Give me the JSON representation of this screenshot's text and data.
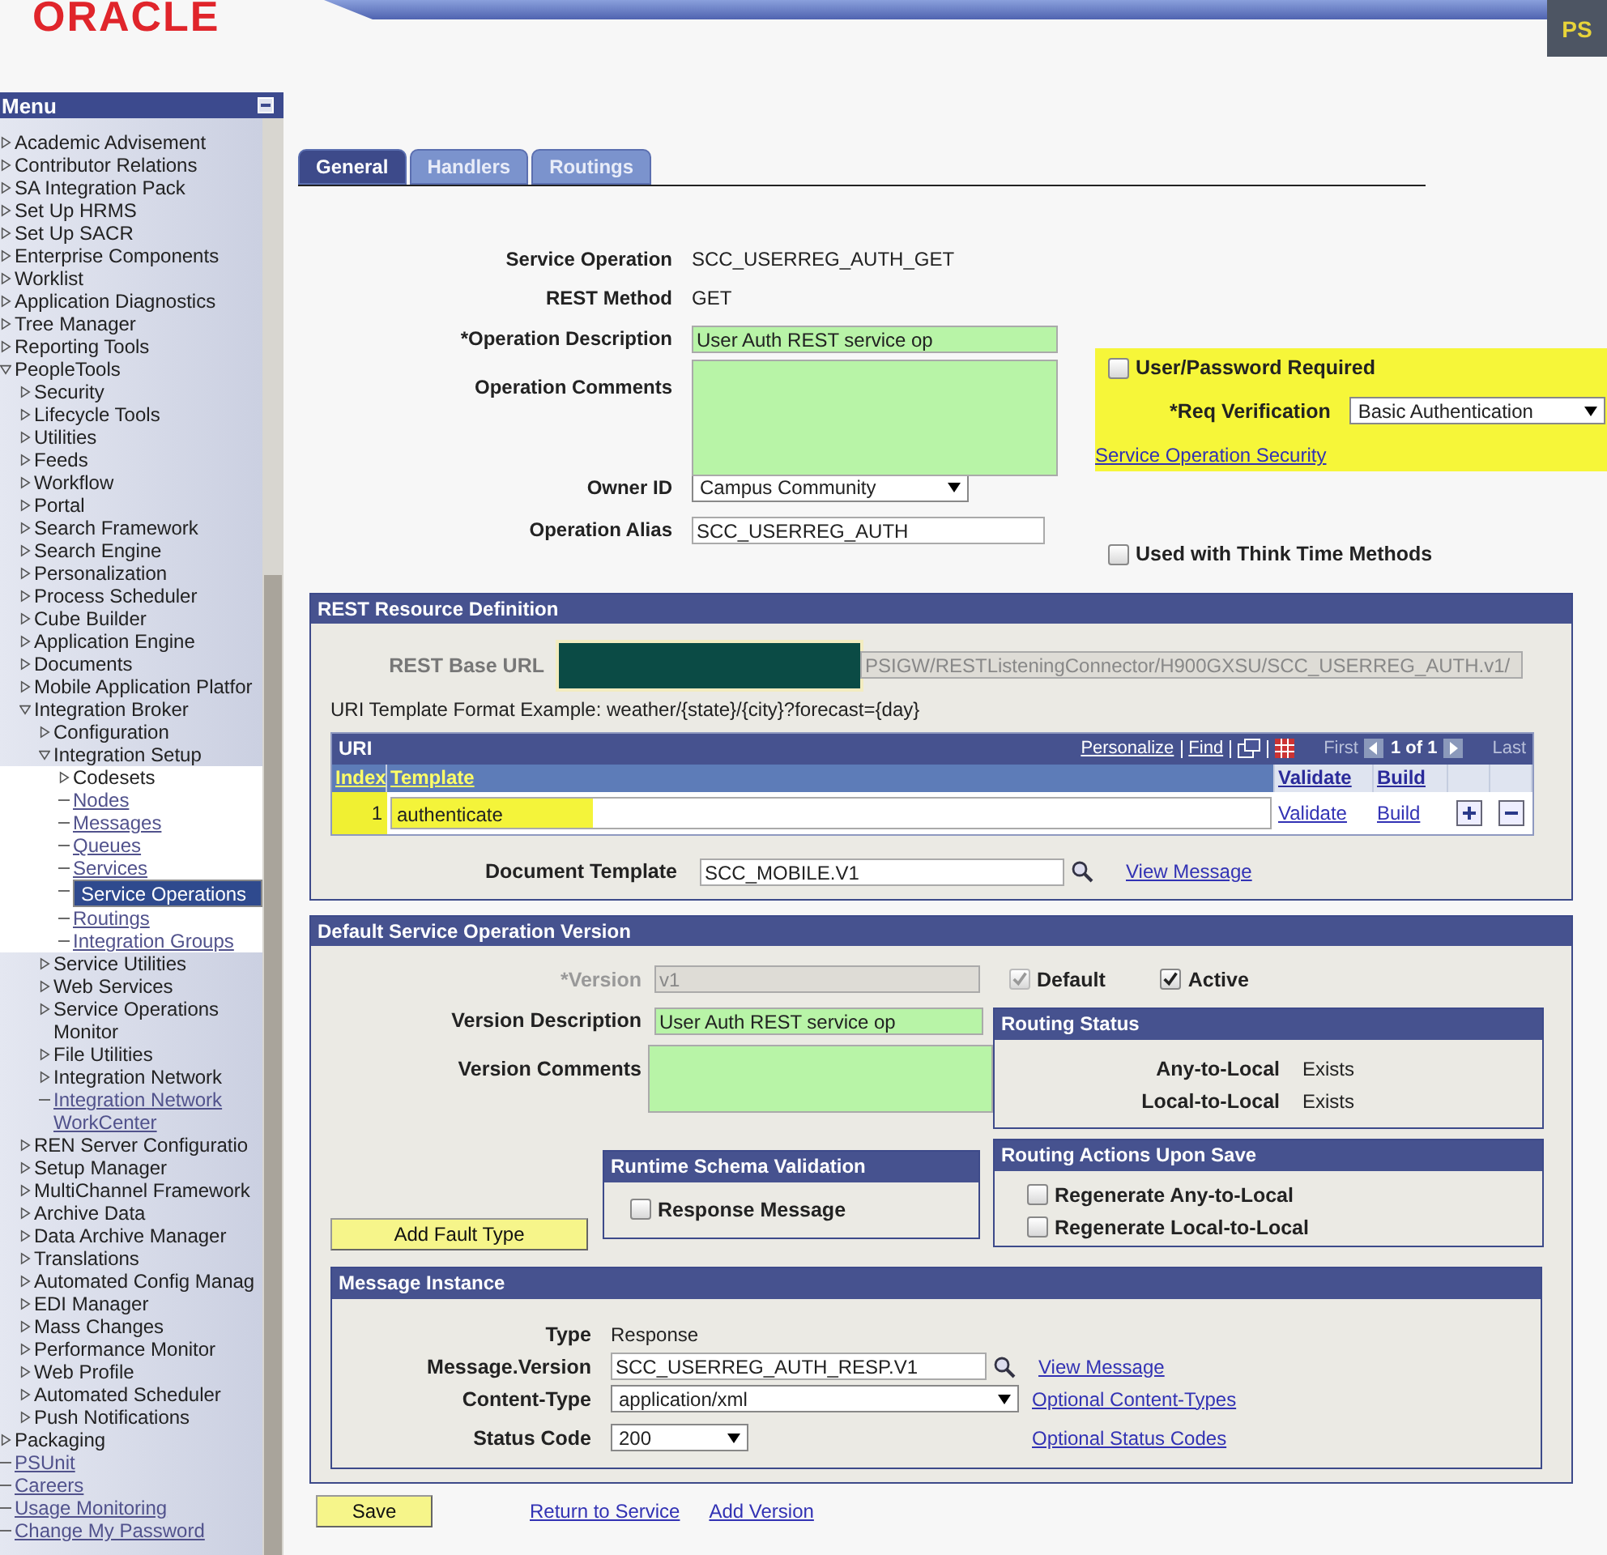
{
  "header": {
    "logo": "ORACLE",
    "badge": "PS"
  },
  "menu": {
    "title": "Menu",
    "items": [
      {
        "label": "Academic Advisement",
        "kind": "folder",
        "expanded": false
      },
      {
        "label": "Contributor Relations",
        "kind": "folder",
        "expanded": false
      },
      {
        "label": "SA Integration Pack",
        "kind": "folder",
        "expanded": false
      },
      {
        "label": "Set Up HRMS",
        "kind": "folder",
        "expanded": false
      },
      {
        "label": "Set Up SACR",
        "kind": "folder",
        "expanded": false
      },
      {
        "label": "Enterprise Components",
        "kind": "folder",
        "expanded": false
      },
      {
        "label": "Worklist",
        "kind": "folder",
        "expanded": false
      },
      {
        "label": "Application Diagnostics",
        "kind": "folder",
        "expanded": false
      },
      {
        "label": "Tree Manager",
        "kind": "folder",
        "expanded": false
      },
      {
        "label": "Reporting Tools",
        "kind": "folder",
        "expanded": false
      },
      {
        "label": "PeopleTools",
        "kind": "folder",
        "expanded": true,
        "children": [
          {
            "label": "Security",
            "kind": "folder",
            "expanded": false
          },
          {
            "label": "Lifecycle Tools",
            "kind": "folder",
            "expanded": false
          },
          {
            "label": "Utilities",
            "kind": "folder",
            "expanded": false
          },
          {
            "label": "Feeds",
            "kind": "folder",
            "expanded": false
          },
          {
            "label": "Workflow",
            "kind": "folder",
            "expanded": false
          },
          {
            "label": "Portal",
            "kind": "folder",
            "expanded": false
          },
          {
            "label": "Search Framework",
            "kind": "folder",
            "expanded": false
          },
          {
            "label": "Search Engine",
            "kind": "folder",
            "expanded": false
          },
          {
            "label": "Personalization",
            "kind": "folder",
            "expanded": false
          },
          {
            "label": "Process Scheduler",
            "kind": "folder",
            "expanded": false
          },
          {
            "label": "Cube Builder",
            "kind": "folder",
            "expanded": false
          },
          {
            "label": "Application Engine",
            "kind": "folder",
            "expanded": false
          },
          {
            "label": "Documents",
            "kind": "folder",
            "expanded": false
          },
          {
            "label": "Mobile Application Platfor",
            "kind": "folder",
            "expanded": false
          },
          {
            "label": "Integration Broker",
            "kind": "folder",
            "expanded": true,
            "children": [
              {
                "label": "Configuration",
                "kind": "folder",
                "expanded": false
              },
              {
                "label": "Integration Setup",
                "kind": "folder",
                "expanded": true,
                "children": [
                  {
                    "label": "Codesets",
                    "kind": "folder",
                    "expanded": false
                  },
                  {
                    "label": "Nodes",
                    "kind": "link",
                    "selected": false
                  },
                  {
                    "label": "Messages",
                    "kind": "link",
                    "selected": false
                  },
                  {
                    "label": "Queues",
                    "kind": "link",
                    "selected": false
                  },
                  {
                    "label": "Services",
                    "kind": "link",
                    "selected": false
                  },
                  {
                    "label": "Service Operations",
                    "kind": "link",
                    "selected": true
                  },
                  {
                    "label": "Routings",
                    "kind": "link",
                    "selected": false
                  },
                  {
                    "label": "Integration Groups",
                    "kind": "link",
                    "selected": false
                  }
                ]
              },
              {
                "label": "Service Utilities",
                "kind": "folder",
                "expanded": false
              },
              {
                "label": "Web Services",
                "kind": "folder",
                "expanded": false
              },
              {
                "label": "Service Operations Monitor",
                "kind": "folder",
                "expanded": false
              },
              {
                "label": "File Utilities",
                "kind": "folder",
                "expanded": false
              },
              {
                "label": "Integration Network",
                "kind": "folder",
                "expanded": false
              },
              {
                "label": "Integration Network WorkCenter",
                "kind": "link",
                "selected": false
              }
            ]
          },
          {
            "label": "REN Server Configuratio",
            "kind": "folder",
            "expanded": false
          },
          {
            "label": "Setup Manager",
            "kind": "folder",
            "expanded": false
          },
          {
            "label": "MultiChannel Framework",
            "kind": "folder",
            "expanded": false
          },
          {
            "label": "Archive Data",
            "kind": "folder",
            "expanded": false
          },
          {
            "label": "Data Archive Manager",
            "kind": "folder",
            "expanded": false
          },
          {
            "label": "Translations",
            "kind": "folder",
            "expanded": false
          },
          {
            "label": "Automated Config Manag",
            "kind": "folder",
            "expanded": false
          },
          {
            "label": "EDI Manager",
            "kind": "folder",
            "expanded": false
          },
          {
            "label": "Mass Changes",
            "kind": "folder",
            "expanded": false
          },
          {
            "label": "Performance Monitor",
            "kind": "folder",
            "expanded": false
          },
          {
            "label": "Web Profile",
            "kind": "folder",
            "expanded": false
          },
          {
            "label": "Automated Scheduler",
            "kind": "folder",
            "expanded": false
          },
          {
            "label": "Push Notifications",
            "kind": "folder",
            "expanded": false
          }
        ]
      },
      {
        "label": "Packaging",
        "kind": "folder",
        "expanded": false
      },
      {
        "label": "PSUnit",
        "kind": "link",
        "selected": false
      },
      {
        "label": "Careers",
        "kind": "link",
        "selected": false
      },
      {
        "label": "Usage Monitoring",
        "kind": "link",
        "selected": false
      },
      {
        "label": "Change My Password",
        "kind": "link",
        "selected": false
      }
    ]
  },
  "tabs": [
    {
      "label": "General",
      "selected": true
    },
    {
      "label": "Handlers",
      "selected": false
    },
    {
      "label": "Routings",
      "selected": false
    }
  ],
  "general": {
    "service_operation": {
      "label": "Service Operation",
      "value": "SCC_USERREG_AUTH_GET"
    },
    "rest_method": {
      "label": "REST Method",
      "value": "GET"
    },
    "operation_description": {
      "label": "*Operation Description",
      "value": "User Auth REST service op",
      "highlighted": true
    },
    "operation_comments": {
      "label": "Operation Comments",
      "highlighted": true
    },
    "owner_id": {
      "label": "Owner ID",
      "value": "Campus Community"
    },
    "operation_alias": {
      "label": "Operation Alias",
      "value": "SCC_USERREG_AUTH",
      "highlighted": false
    },
    "user_password_required": {
      "label": "User/Password Required",
      "checked": false
    },
    "req_verification": {
      "label": "*Req Verification",
      "value": "Basic Authentication",
      "annotated": true
    },
    "security_link": "Service Operation Security",
    "think_time": {
      "label": "Used with Think Time Methods",
      "checked": false
    }
  },
  "rest_resource": {
    "title": "REST Resource Definition",
    "base_url_label": "REST Base URL",
    "base_url_value": "PSIGW/RESTListeningConnector/H900GXSU/SCC_USERREG_AUTH.v1/",
    "format_example": "URI Template Format Example: weather/{state}/{city}?forecast={day}",
    "uri_grid": {
      "title": "URI",
      "personalize": "Personalize",
      "find": "Find",
      "first": "First",
      "count": "1 of 1",
      "last": "Last",
      "columns": [
        "Index",
        "Template",
        "Validate",
        "Build"
      ],
      "rows": [
        {
          "index": "1",
          "template": "authenticate",
          "validate": "Validate",
          "build": "Build",
          "annotated": true
        }
      ]
    },
    "document_template": {
      "label": "Document Template",
      "value": "SCC_MOBILE.V1",
      "link": "View Message"
    }
  },
  "version": {
    "title": "Default Service Operation Version",
    "version": {
      "label": "*Version",
      "value": "v1",
      "disabled": true
    },
    "default": {
      "label": "Default",
      "checked": true,
      "disabled": true
    },
    "active": {
      "label": "Active",
      "checked": true,
      "disabled": false
    },
    "description": {
      "label": "Version Description",
      "value": "User Auth REST service op",
      "highlighted": true
    },
    "comments": {
      "label": "Version Comments",
      "highlighted": true
    },
    "routing_status": {
      "title": "Routing Status",
      "rows": [
        {
          "label": "Any-to-Local",
          "value": "Exists"
        },
        {
          "label": "Local-to-Local",
          "value": "Exists"
        }
      ]
    },
    "runtime_validation": {
      "title": "Runtime Schema Validation",
      "options": [
        {
          "label": "Response Message",
          "checked": false
        }
      ]
    },
    "routing_actions": {
      "title": "Routing Actions Upon Save",
      "options": [
        {
          "label": "Regenerate Any-to-Local",
          "checked": false
        },
        {
          "label": "Regenerate Local-to-Local",
          "checked": false
        }
      ]
    },
    "add_fault_button": "Add Fault Type",
    "message_instance": {
      "title": "Message Instance",
      "type_label": "Type",
      "type_value": "Response",
      "message_version": {
        "label": "Message.Version",
        "value": "SCC_USERREG_AUTH_RESP.V1",
        "link": "View Message"
      },
      "content_type": {
        "label": "Content-Type",
        "value": "application/xml",
        "link": "Optional Content-Types"
      },
      "status_code": {
        "label": "Status Code",
        "value": "200",
        "link": "Optional Status Codes"
      }
    }
  },
  "footer": {
    "save": "Save",
    "links": [
      "Return to Service",
      "Add Version"
    ]
  }
}
